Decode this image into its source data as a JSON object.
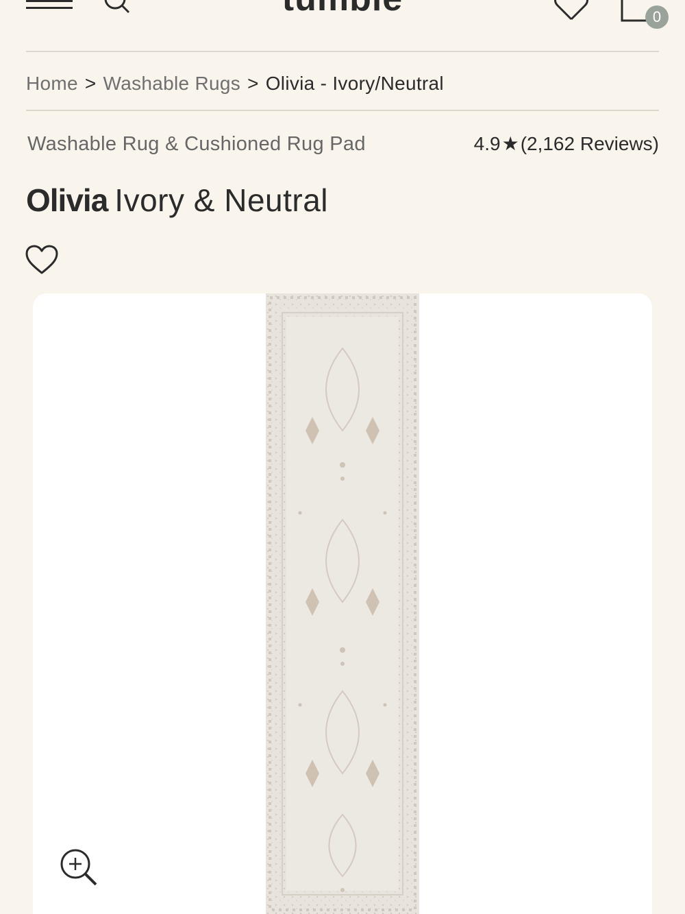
{
  "header": {
    "logo_text": "tumble",
    "cart_count": "0",
    "icons": [
      "menu-icon",
      "search-icon",
      "heart-icon",
      "cart-icon"
    ]
  },
  "breadcrumb": {
    "items": [
      "Home",
      "Washable Rugs",
      "Olivia - Ivory/Neutral"
    ],
    "separator": ">"
  },
  "product": {
    "subtitle": "Washable Rug & Cushioned Rug Pad",
    "rating": "4.9",
    "rating_star": "★",
    "reviews": "(2,162 Reviews)",
    "name": "Olivia",
    "variant": "Ivory & Neutral"
  },
  "gallery": {
    "zoom_icon": "zoom-in-icon"
  },
  "colors": {
    "background": "#f9f4ec",
    "text": "#2b2b2b",
    "muted_text": "#6f6f6f",
    "badge": "#9aa39a",
    "card": "#ffffff"
  }
}
